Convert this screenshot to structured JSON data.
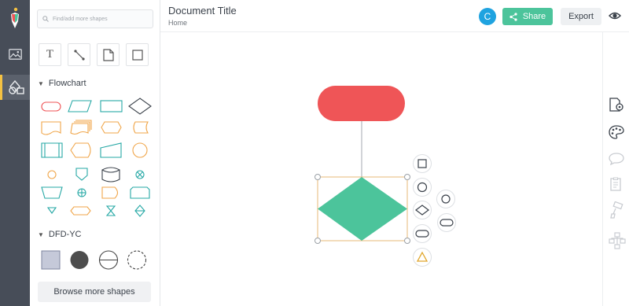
{
  "search": {
    "placeholder": "Find/add more shapes"
  },
  "tools": {
    "text_label": "T"
  },
  "sections": {
    "flowchart": "Flowchart",
    "dfd": "DFD-YC"
  },
  "browse_label": "Browse more shapes",
  "header": {
    "title": "Document Title",
    "breadcrumb": "Home",
    "avatar_initial": "C",
    "share_label": "Share",
    "export_label": "Export"
  },
  "colors": {
    "rail": "#474d58",
    "accent": "#f5c242",
    "share": "#4cc49b",
    "terminator": "#ef5557",
    "decision": "#4cc49b",
    "avatar": "#1fa3e0"
  },
  "rail_icons": [
    "logo-icon",
    "image-icon",
    "shapes-icon"
  ],
  "right_icons": [
    "page-settings-icon",
    "palette-icon",
    "comment-icon",
    "notes-icon",
    "format-painter-icon",
    "diagram-structure-icon"
  ]
}
